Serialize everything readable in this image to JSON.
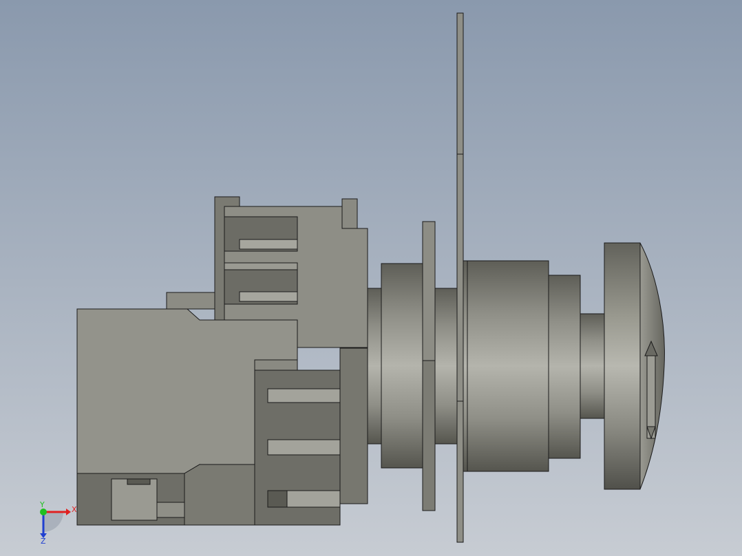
{
  "viewport": {
    "background_top": "#8a99ad",
    "background_bottom": "#c7ccd3"
  },
  "model": {
    "face_light": "#a3a39b",
    "face_mid": "#8d8d85",
    "face_dark": "#6f6f68",
    "face_shadow": "#56564f",
    "edge_color": "#1a1a1a"
  },
  "triad": {
    "x_label": "X",
    "y_label": "Y",
    "z_label": "Z",
    "x_color": "#e02020",
    "y_color": "#20c020",
    "z_color": "#2040d0"
  }
}
